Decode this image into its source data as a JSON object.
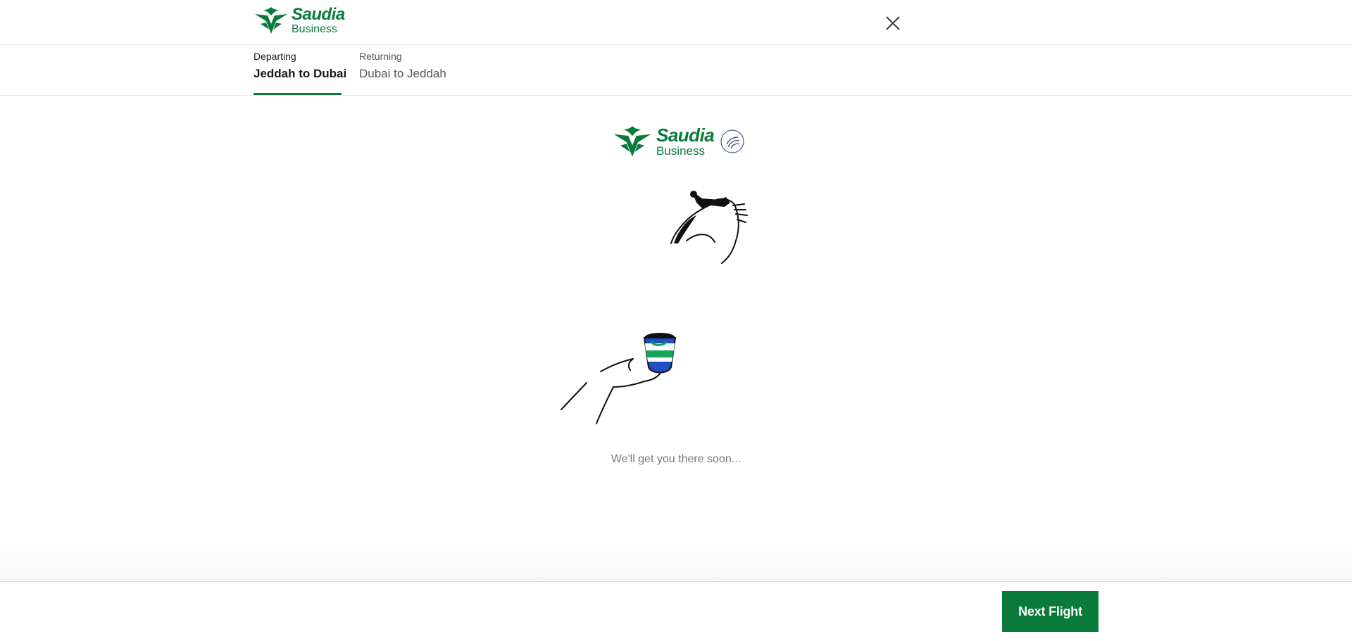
{
  "header": {
    "brand_name": "Saudia",
    "brand_sub": "Business",
    "close_icon": "close-icon"
  },
  "tabs": [
    {
      "caption": "Departing",
      "route": "Jeddah to Dubai",
      "active": true
    },
    {
      "caption": "Returning",
      "route": "Dubai to Jeddah",
      "active": false
    }
  ],
  "content": {
    "brand_name": "Saudia",
    "brand_sub": "Business",
    "loading_text": "We'll get you there soon..."
  },
  "footer": {
    "next_label": "Next Flight"
  },
  "colors": {
    "brand_green": "#0a7a3b",
    "cup_blue": "#1f4fc4",
    "cup_green": "#17a55a"
  }
}
